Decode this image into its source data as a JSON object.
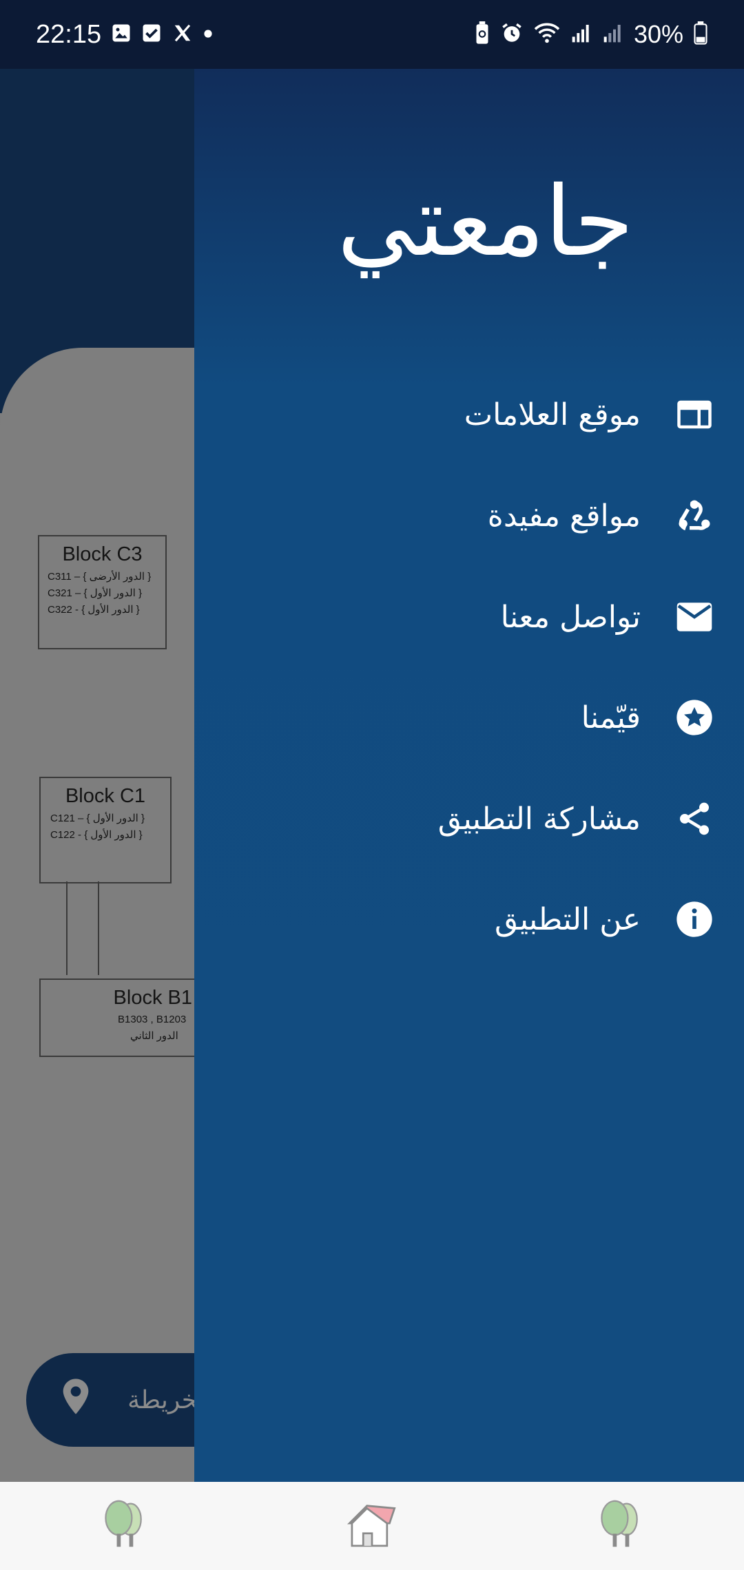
{
  "status_bar": {
    "time": "22:15",
    "battery": "30%",
    "left_icons": [
      "gallery-icon",
      "check-icon",
      "x-icon",
      "dot-icon"
    ],
    "right_icons": [
      "battery-saver-icon",
      "alarm-icon",
      "wifi-icon",
      "signal-icon",
      "signal-icon",
      "battery-icon"
    ]
  },
  "drawer": {
    "title": "جامعتي",
    "items": [
      {
        "label": "موقع العلامات",
        "icon": "web-icon"
      },
      {
        "label": "مواقع مفيدة",
        "icon": "webhook-icon"
      },
      {
        "label": "تواصل معنا",
        "icon": "mail-icon"
      },
      {
        "label": "قيّمنا",
        "icon": "star-circle-icon"
      },
      {
        "label": "مشاركة التطبيق",
        "icon": "share-icon"
      },
      {
        "label": "عن التطبيق",
        "icon": "info-icon"
      }
    ]
  },
  "background": {
    "blocks": [
      {
        "title": "Block C3",
        "lines": [
          "C311 – { الدور الأرضى }",
          "C321 – { الدور الأول }",
          "C322 - { الدور الأول }"
        ]
      },
      {
        "title": "Block C1",
        "lines": [
          "C121 – { الدور الأول }",
          "C122 - { الدور الأول }"
        ]
      },
      {
        "title": "Block B1",
        "lines": [
          "B1303 , B1203",
          "الدور الثاني"
        ]
      }
    ],
    "map_button": {
      "label": "الخريطة",
      "icon": "location-pin-icon"
    }
  },
  "bottom_nav": [
    {
      "icon": "trees-icon"
    },
    {
      "icon": "home-icon"
    },
    {
      "icon": "trees-icon"
    }
  ],
  "colors": {
    "drawer": "#124c80",
    "header": "#0f2847",
    "scrim": "#7d7d7d"
  }
}
